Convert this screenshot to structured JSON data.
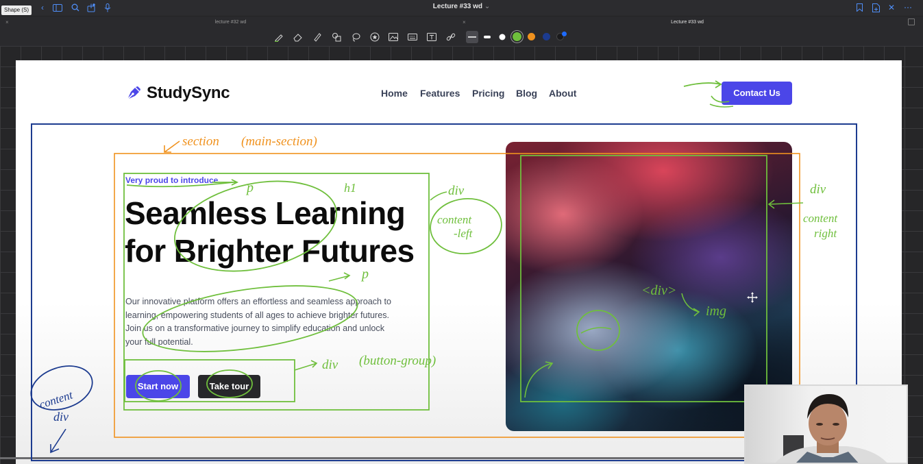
{
  "app": {
    "tooltip": "Shape (S)",
    "window_title": "Lecture #33 wd",
    "title_caret": "⌄",
    "tabs": [
      {
        "label": "lecture #32 wd",
        "active": false
      },
      {
        "label": "Lecture #33 wd",
        "active": true
      }
    ],
    "left_icons": [
      "back-icon",
      "sidebar-icon",
      "search-icon",
      "share-icon",
      "microphone-icon"
    ],
    "right_icons": [
      "bookmark-icon",
      "add-page-icon",
      "close-icon",
      "more-icon"
    ],
    "tools": [
      "pen-icon",
      "eraser-icon",
      "highlighter-icon",
      "shapes-icon",
      "lasso-icon",
      "star-sticker-icon",
      "image-icon",
      "keyboard-icon",
      "text-box-icon",
      "link-icon"
    ],
    "stroke_widths": [
      "thin",
      "medium",
      "thick"
    ],
    "colors": {
      "green": "#6fbf3c",
      "orange": "#f0921e",
      "navy": "#1c3b8f",
      "blue": "#1e6bff",
      "white": "#ffffff"
    },
    "selected_color": "green"
  },
  "site": {
    "brand": "StudySync",
    "nav": [
      "Home",
      "Features",
      "Pricing",
      "Blog",
      "About"
    ],
    "cta": "Contact Us",
    "eyebrow": "Very proud to introduce",
    "title_line1": "Seamless Learning",
    "title_line2": "for Brighter Futures",
    "description": "Our innovative platform offers an effortless and seamless approach to learning, empowering students of all ages to achieve brighter futures. Join us on a transformative journey to simplify education and unlock your full potential.",
    "btn_primary": "Start now",
    "btn_secondary": "Take tour",
    "accent": "#4b46e8"
  },
  "annotations": {
    "section": "section",
    "main_section": "(main-section)",
    "p1": "p",
    "h1": "h1",
    "p2": "p",
    "div_left": "div",
    "content_left_1": "content",
    "content_left_2": "-left",
    "div_right": "div",
    "content_right_1": "content",
    "content_right_2": "right",
    "div_tag": "<div>",
    "img": "img",
    "div_btn": "div",
    "btn_group": "(button-group)",
    "content_1": "content",
    "content_2": "div"
  }
}
